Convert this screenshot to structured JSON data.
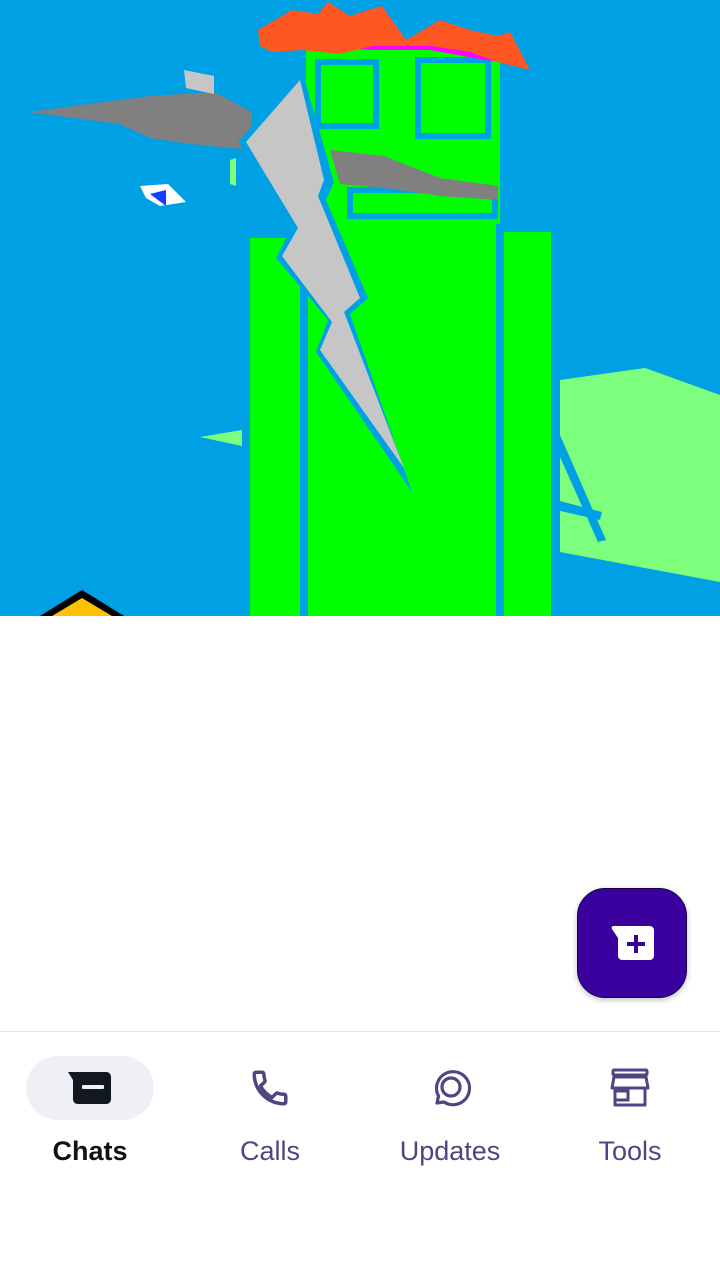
{
  "colors": {
    "fab_background": "#3a019f",
    "nav_active_pill": "#eef0f5",
    "nav_active_text": "#121212",
    "nav_inactive": "#4d4683",
    "hero_sky": "#00a0e4",
    "hero_green": "#00ff00"
  },
  "fab": {
    "icon": "new-chat-icon"
  },
  "bottom_nav": {
    "items": [
      {
        "label": "Chats",
        "icon": "chat-box-icon",
        "active": true
      },
      {
        "label": "Calls",
        "icon": "phone-icon",
        "active": false
      },
      {
        "label": "Updates",
        "icon": "updates-icon",
        "active": false
      },
      {
        "label": "Tools",
        "icon": "storefront-icon",
        "active": false
      }
    ]
  }
}
